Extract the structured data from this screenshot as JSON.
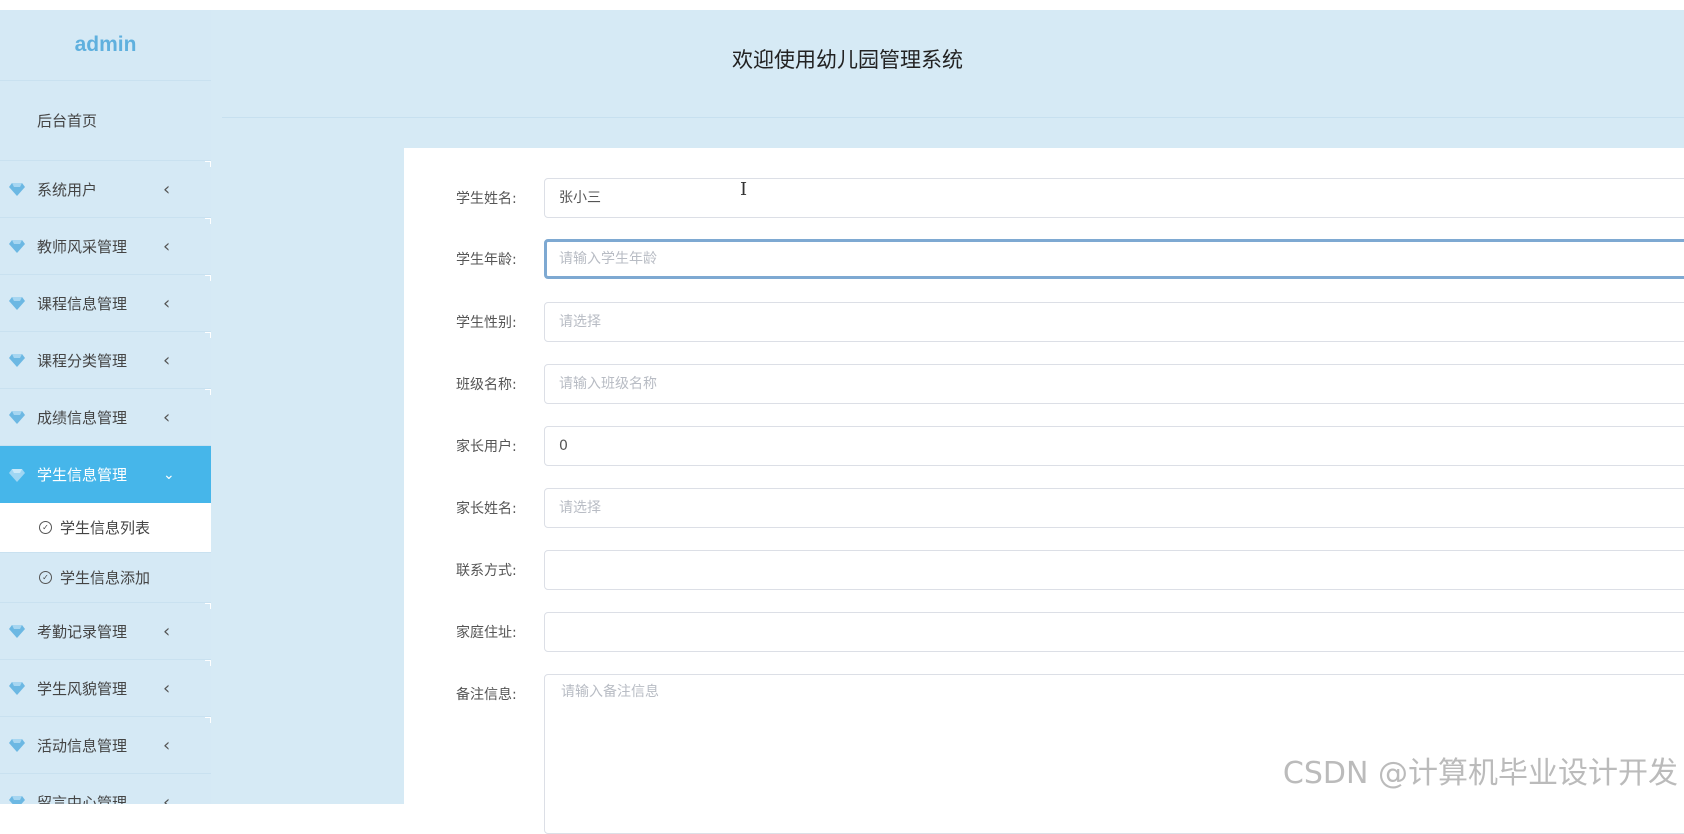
{
  "app": {
    "title": "欢迎使用幼儿园管理系统",
    "brand": "admin"
  },
  "sidebar": {
    "home_label": "后台首页",
    "items": [
      {
        "label": "系统用户",
        "expanded": false
      },
      {
        "label": "教师风采管理",
        "expanded": false
      },
      {
        "label": "课程信息管理",
        "expanded": false
      },
      {
        "label": "课程分类管理",
        "expanded": false
      },
      {
        "label": "成绩信息管理",
        "expanded": false
      },
      {
        "label": "学生信息管理",
        "expanded": true,
        "children": [
          {
            "label": "学生信息列表",
            "current": true
          },
          {
            "label": "学生信息添加",
            "current": false
          }
        ]
      },
      {
        "label": "考勤记录管理",
        "expanded": false
      },
      {
        "label": "学生风貌管理",
        "expanded": false
      },
      {
        "label": "活动信息管理",
        "expanded": false
      },
      {
        "label": "留言中心管理",
        "expanded": false
      }
    ],
    "colors": {
      "background": "#d5e9f5",
      "active": "#46b6ea",
      "brand": "#5fb0de"
    },
    "icons": {
      "menu": "gem-icon",
      "collapsed": "chevron-left-icon",
      "expanded": "chevron-down-icon",
      "sub": "check-circle-icon"
    }
  },
  "form": {
    "fields": [
      {
        "label": "学生姓名:",
        "value": "张小三",
        "placeholder": ""
      },
      {
        "label": "学生年龄:",
        "value": "",
        "placeholder": "请输入学生年龄",
        "focused": true
      },
      {
        "label": "学生性别:",
        "value": "",
        "placeholder": "请选择"
      },
      {
        "label": "班级名称:",
        "value": "",
        "placeholder": "请输入班级名称"
      },
      {
        "label": "家长用户:",
        "value": "0",
        "placeholder": ""
      },
      {
        "label": "家长姓名:",
        "value": "",
        "placeholder": "请选择"
      },
      {
        "label": "联系方式:",
        "value": "",
        "placeholder": ""
      },
      {
        "label": "家庭住址:",
        "value": "",
        "placeholder": ""
      }
    ],
    "remarks": {
      "label": "备注信息:",
      "placeholder": "请输入备注信息"
    }
  },
  "watermark": "CSDN @计算机毕业设计开发"
}
